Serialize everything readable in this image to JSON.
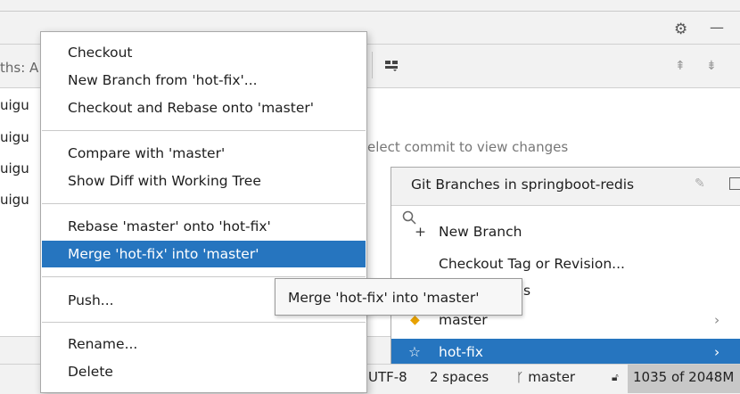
{
  "log_panel": {
    "paths_label": "ths: A",
    "author_rows": [
      "uigu",
      "uigu",
      "uigu",
      "uigu"
    ],
    "placeholder": "elect commit to view changes"
  },
  "context_menu": {
    "items": [
      {
        "label": "Checkout"
      },
      {
        "label": "New Branch from 'hot-fix'..."
      },
      {
        "label": "Checkout and Rebase onto 'master'"
      },
      {
        "label": "Compare with 'master'"
      },
      {
        "label": "Show Diff with Working Tree"
      },
      {
        "label": "Rebase 'master' onto 'hot-fix'"
      },
      {
        "label": "Merge 'hot-fix' into 'master'",
        "selected": true
      },
      {
        "label": "Push..."
      },
      {
        "label": "Rename..."
      },
      {
        "label": "Delete"
      }
    ]
  },
  "tooltip": {
    "text": "Merge 'hot-fix' into 'master'"
  },
  "branches_popup": {
    "title": "Git Branches in springboot-redis",
    "rows": {
      "new_branch": "New Branch",
      "checkout_tag": "Checkout Tag or Revision...",
      "group_suffix": "s",
      "master": "master",
      "hot_fix": "hot-fix"
    }
  },
  "status_bar": {
    "encoding": "UTF-8",
    "indent": "2 spaces",
    "branch": "master",
    "position": "1035 of 2048M"
  },
  "colors": {
    "selection": "#2675bf",
    "tag_icon": "#e8a200"
  },
  "icons": [
    "gear-icon",
    "minimize-icon",
    "layout-icon",
    "expand-icon",
    "collapse-icon",
    "search-icon",
    "edit-icon",
    "window-icon",
    "tag-icon",
    "star-icon",
    "chevron-right-icon",
    "branch-icon",
    "lock-icon"
  ]
}
